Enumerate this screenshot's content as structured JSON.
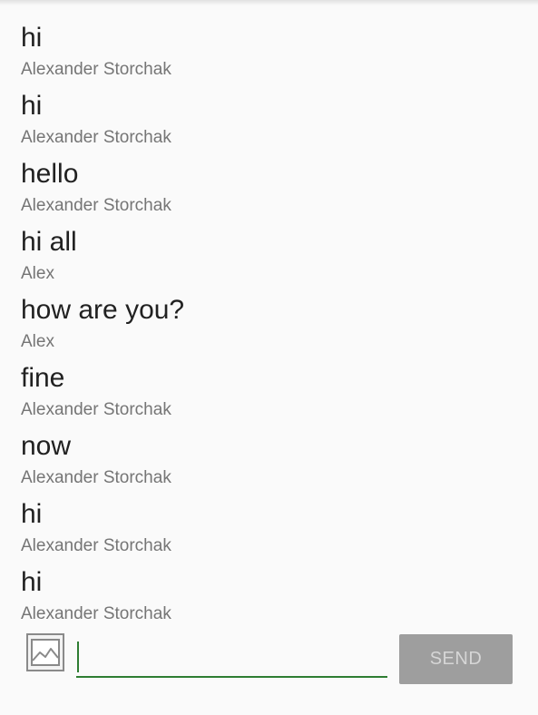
{
  "messages": [
    {
      "text": "hi",
      "author": "Alexander Storchak"
    },
    {
      "text": "hi",
      "author": "Alexander Storchak"
    },
    {
      "text": "hello",
      "author": "Alexander Storchak"
    },
    {
      "text": "hi all",
      "author": "Alex"
    },
    {
      "text": "how are you?",
      "author": "Alex"
    },
    {
      "text": "fine",
      "author": "Alexander Storchak"
    },
    {
      "text": "now",
      "author": "Alexander Storchak"
    },
    {
      "text": "hi",
      "author": "Alexander Storchak"
    },
    {
      "text": "hi",
      "author": "Alexander Storchak"
    }
  ],
  "composer": {
    "input_value": "",
    "send_label": "SEND",
    "image_icon": "image-icon"
  },
  "colors": {
    "background": "#fafafa",
    "message_text": "#212121",
    "author_text": "#757575",
    "input_underline": "#2e7d32",
    "send_button_bg": "#9e9e9e",
    "send_button_text": "#d6d6d6"
  }
}
